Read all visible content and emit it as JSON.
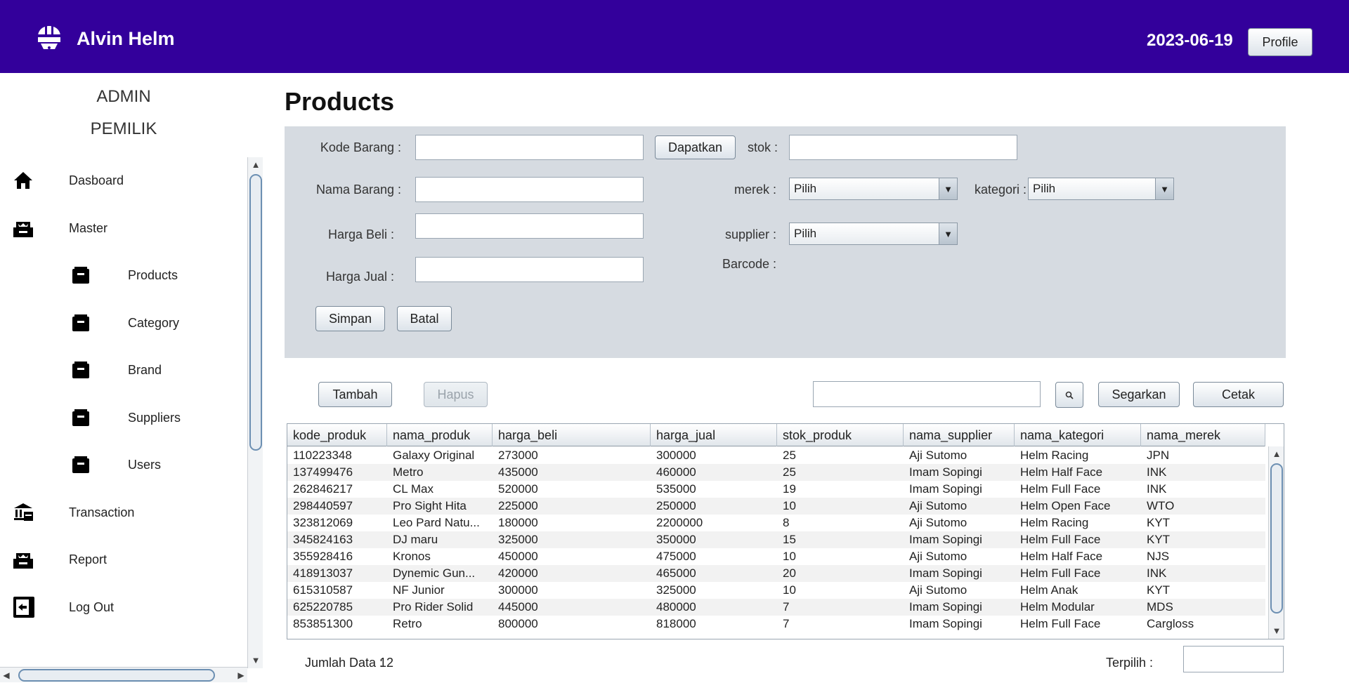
{
  "header": {
    "app_name": "Alvin Helm",
    "date": "2023-06-19",
    "profile_label": "Profile",
    "logo_icon": "helmet-icon",
    "bg_color": "#33009b"
  },
  "sidebar": {
    "role_admin": "ADMIN",
    "role_owner": "PEMILIK",
    "items": [
      {
        "label": "Dasboard",
        "icon": "home-icon"
      },
      {
        "label": "Master",
        "icon": "archive-icon"
      },
      {
        "label": "Products",
        "icon": "box-icon"
      },
      {
        "label": "Category",
        "icon": "box-icon"
      },
      {
        "label": "Brand",
        "icon": "box-icon"
      },
      {
        "label": "Suppliers",
        "icon": "box-icon"
      },
      {
        "label": "Users",
        "icon": "box-icon"
      },
      {
        "label": "Transaction",
        "icon": "bank-icon"
      },
      {
        "label": "Report",
        "icon": "archive-icon"
      },
      {
        "label": "Log Out",
        "icon": "logout-icon"
      }
    ]
  },
  "page": {
    "title": "Products"
  },
  "form": {
    "kode_label": "Kode Barang :",
    "kode_value": "",
    "dapatkan_label": "Dapatkan",
    "stok_label": "stok :",
    "stok_value": "",
    "nama_label": "Nama Barang :",
    "nama_value": "",
    "merek_label": "merek :",
    "merek_value": "Pilih",
    "kategori_label": "kategori :",
    "kategori_value": "Pilih",
    "beli_label": "Harga Beli :",
    "beli_value": "",
    "supplier_label": "supplier :",
    "supplier_value": "Pilih",
    "jual_label": "Harga Jual :",
    "jual_value": "",
    "barcode_label": "Barcode :",
    "simpan_label": "Simpan",
    "batal_label": "Batal"
  },
  "toolbar": {
    "tambah_label": "Tambah",
    "hapus_label": "Hapus",
    "search_value": "",
    "segarkan_label": "Segarkan",
    "cetak_label": "Cetak"
  },
  "table": {
    "columns": [
      "kode_produk",
      "nama_produk",
      "harga_beli",
      "harga_jual",
      "stok_produk",
      "nama_supplier",
      "nama_kategori",
      "nama_merek"
    ],
    "rows": [
      [
        "110223348",
        "Galaxy Original",
        "273000",
        "300000",
        "25",
        "Aji Sutomo",
        "Helm Racing",
        "JPN"
      ],
      [
        "137499476",
        "Metro",
        "435000",
        "460000",
        "25",
        "Imam Sopingi",
        "Helm Half Face",
        "INK"
      ],
      [
        "262846217",
        "CL Max",
        "520000",
        "535000",
        "19",
        "Imam Sopingi",
        "Helm Full Face",
        "INK"
      ],
      [
        "298440597",
        "Pro Sight Hita",
        "225000",
        "250000",
        "10",
        "Aji Sutomo",
        "Helm Open Face",
        "WTO"
      ],
      [
        "323812069",
        "Leo Pard Natu...",
        "180000",
        "2200000",
        "8",
        "Aji Sutomo",
        "Helm Racing",
        "KYT"
      ],
      [
        "345824163",
        " DJ maru",
        "325000",
        "350000",
        "15",
        "Imam Sopingi",
        "Helm Full Face",
        "KYT"
      ],
      [
        "355928416",
        "Kronos",
        "450000",
        "475000",
        "10",
        "Aji Sutomo",
        "Helm Half Face",
        "NJS"
      ],
      [
        "418913037",
        "Dynemic Gun...",
        "420000",
        "465000",
        "20",
        "Imam Sopingi",
        "Helm Full Face",
        "INK"
      ],
      [
        "615310587",
        "NF Junior",
        "300000",
        "325000",
        "10",
        "Aji Sutomo",
        "Helm Anak",
        "KYT"
      ],
      [
        "625220785",
        "Pro Rider Solid",
        "445000",
        "480000",
        "7",
        "Imam Sopingi",
        "Helm Modular",
        "MDS"
      ],
      [
        "853851300",
        "Retro",
        "800000",
        "818000",
        "7",
        "Imam Sopingi",
        "Helm Full Face",
        "Cargloss"
      ]
    ]
  },
  "footer": {
    "count_label": "Jumlah Data :",
    "count_value": "12",
    "selected_label": "Terpilih :",
    "selected_value": ""
  }
}
